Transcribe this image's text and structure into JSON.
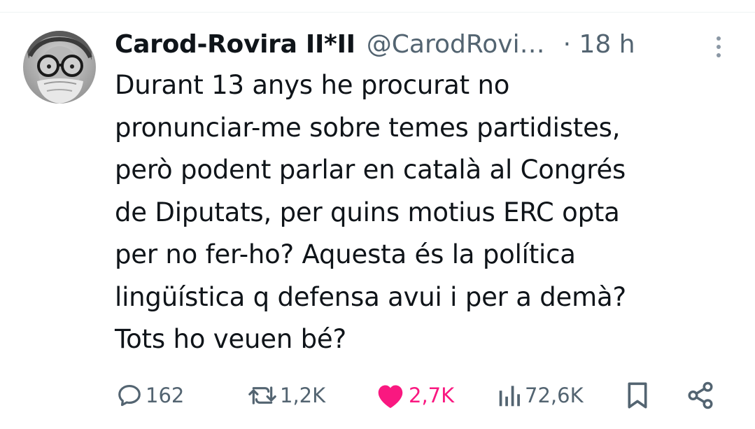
{
  "tweet": {
    "author_name": "Carod-Rovira II*II",
    "handle": "@CarodRovi…",
    "time": "· 18 h",
    "lines": [
      "Durant 13 anys he procurat no",
      "pronunciar-me sobre temes partidistes,",
      "però podent parlar en català al Congrés",
      "de Diputats, per quins motius ERC opta",
      "per no fer-ho? Aquesta és la política",
      "lingüística q defensa avui i per a demà?",
      "Tots ho veuen bé?"
    ]
  },
  "actions": {
    "replies": "162",
    "retweets": "1,2K",
    "likes": "2,7K",
    "views": "72,6K"
  },
  "colors": {
    "text": "#0f1419",
    "secondary": "#536471",
    "like": "#f91880"
  },
  "icons": [
    "reply-icon",
    "retweet-icon",
    "heart-icon",
    "views-icon",
    "bookmark-icon",
    "share-icon",
    "more-icon"
  ]
}
